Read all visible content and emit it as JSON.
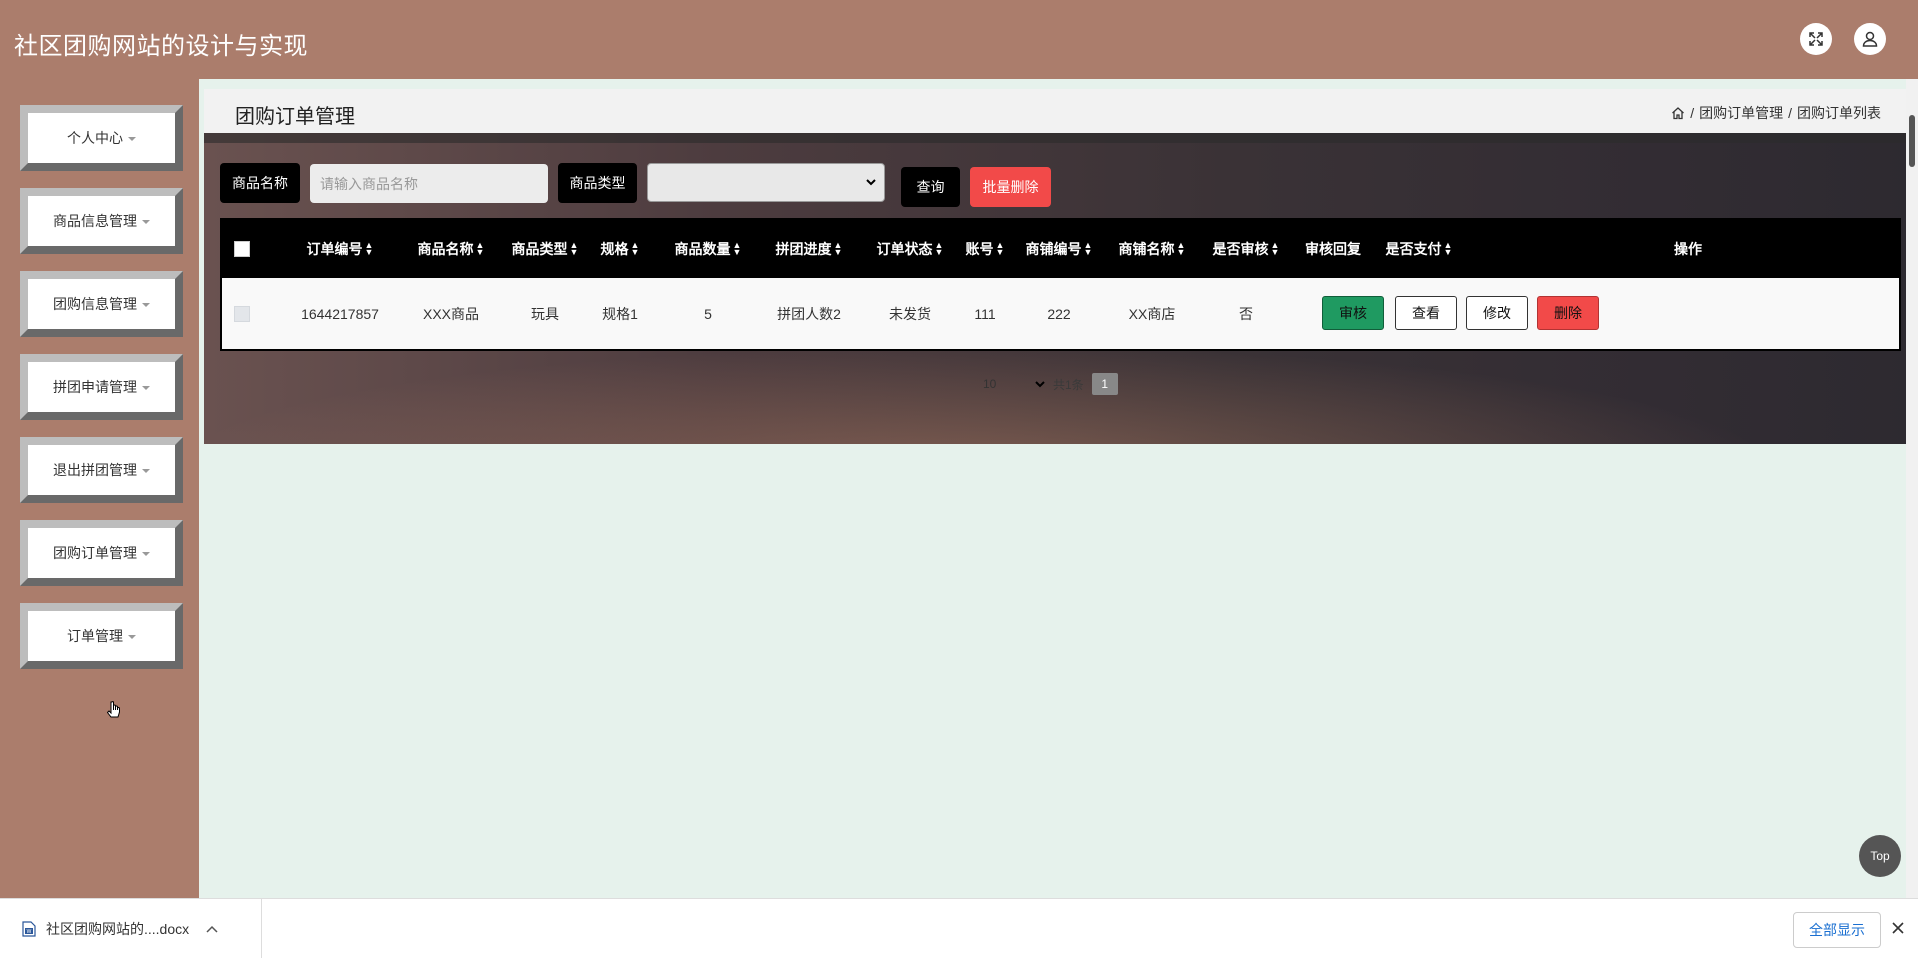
{
  "app": {
    "title": "社区团购网站的设计与实现"
  },
  "header": {
    "fullscreen_icon": "fullscreen-icon",
    "user_icon": "user-icon"
  },
  "sidebar": {
    "items": [
      {
        "label": "个人中心"
      },
      {
        "label": "商品信息管理"
      },
      {
        "label": "团购信息管理"
      },
      {
        "label": "拼团申请管理"
      },
      {
        "label": "退出拼团管理"
      },
      {
        "label": "团购订单管理"
      },
      {
        "label": "订单管理"
      }
    ]
  },
  "page": {
    "title": "团购订单管理",
    "breadcrumb": {
      "level1": "团购订单管理",
      "level2": "团购订单列表",
      "separator": "/"
    }
  },
  "search": {
    "name_label": "商品名称",
    "name_placeholder": "请输入商品名称",
    "type_label": "商品类型",
    "type_value": "",
    "query_label": "查询",
    "batch_delete_label": "批量删除"
  },
  "table": {
    "columns": [
      "订单编号",
      "商品名称",
      "商品类型",
      "规格",
      "商品数量",
      "拼团进度",
      "订单状态",
      "账号",
      "商铺编号",
      "商铺名称",
      "是否审核",
      "审核回复",
      "是否支付",
      "操作"
    ],
    "rows": [
      {
        "order_no": "1644217857",
        "product_name": "XXX商品",
        "product_type": "玩具",
        "spec": "规格1",
        "quantity": "5",
        "progress": "拼团人数2",
        "status": "未发货",
        "account": "111",
        "shop_no": "222",
        "shop_name": "XX商店",
        "reviewed": "否",
        "review_reply": "",
        "paid": ""
      }
    ],
    "actions": {
      "review": "审核",
      "view": "查看",
      "edit": "修改",
      "delete": "删除"
    }
  },
  "pagination": {
    "page_size": "10",
    "total_text": "共1条",
    "current_page": "1"
  },
  "top_button": "Top",
  "download_bar": {
    "file_name": "社区团购网站的....docx",
    "show_all": "全部显示"
  },
  "colors": {
    "header": "#ab7d6c",
    "content_bg": "#e6f2ec",
    "review": "#1f9a61",
    "danger": "#f24a49"
  }
}
